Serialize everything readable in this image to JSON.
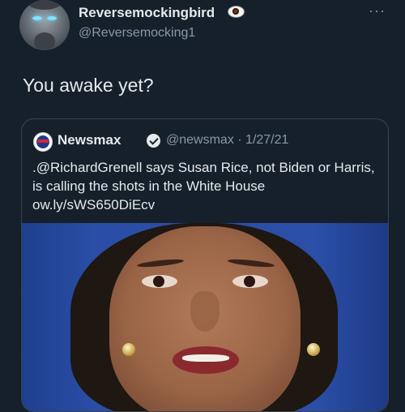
{
  "author": {
    "display_name": "Reversemockingbird",
    "handle": "@Reversemocking1",
    "name_emoji": "eye-emoji"
  },
  "tweet": {
    "text": "You awake yet?"
  },
  "more_label": "···",
  "quoted_tweet": {
    "account_name": "Newsmax",
    "verified": true,
    "meta": "@newsmax · 1/27/21",
    "text": ".@RichardGrenell says Susan Rice, not Biden or Harris, is calling the shots in the White House ow.ly/sWS650DiEcv",
    "has_image": true
  },
  "colors": {
    "background": "#15202b",
    "text": "#e7e9ea",
    "secondary_text": "#8b98a5",
    "border": "#38444d"
  }
}
